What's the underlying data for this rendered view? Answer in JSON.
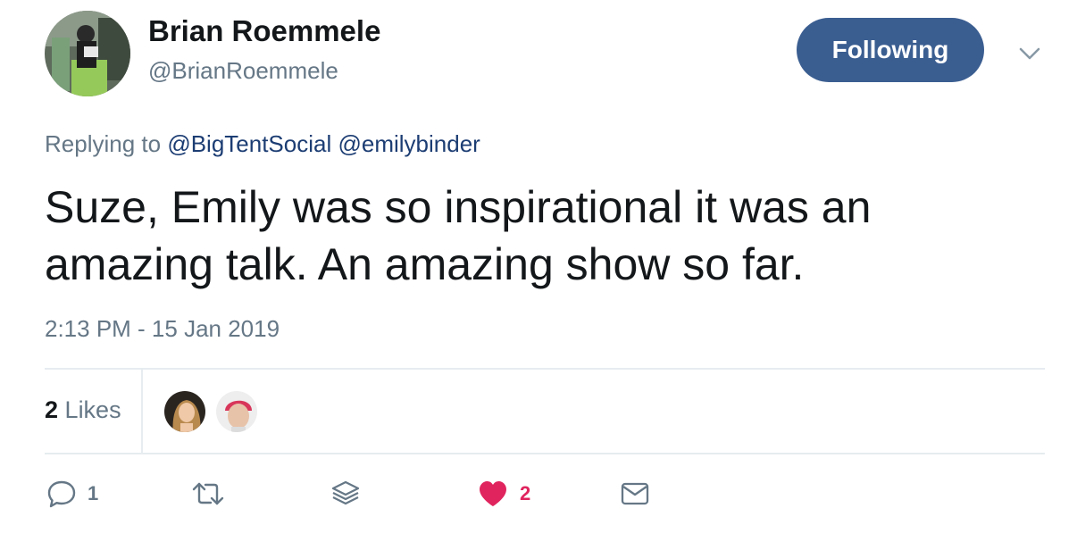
{
  "author": {
    "name": "Brian Roemmele",
    "handle": "@BrianRoemmele"
  },
  "follow_button": {
    "label": "Following"
  },
  "reply_context": {
    "prefix": "Replying to",
    "mentions": [
      "@BigTentSocial",
      "@emilybinder"
    ]
  },
  "tweet": {
    "text": "Suze, Emily was so inspirational it was an amazing talk. An amazing show so far.",
    "timestamp": "2:13 PM - 15 Jan 2019"
  },
  "stats": {
    "likes_count": "2",
    "likes_label": "Likes"
  },
  "actions": {
    "reply_count": "1",
    "like_count": "2",
    "icons": [
      "reply-icon",
      "retweet-icon",
      "layers-icon",
      "heart-icon",
      "mail-icon"
    ]
  },
  "colors": {
    "follow_button_bg": "#3b5e91",
    "mention": "#1c3d73",
    "like": "#e0245e",
    "secondary_text": "#657786"
  }
}
